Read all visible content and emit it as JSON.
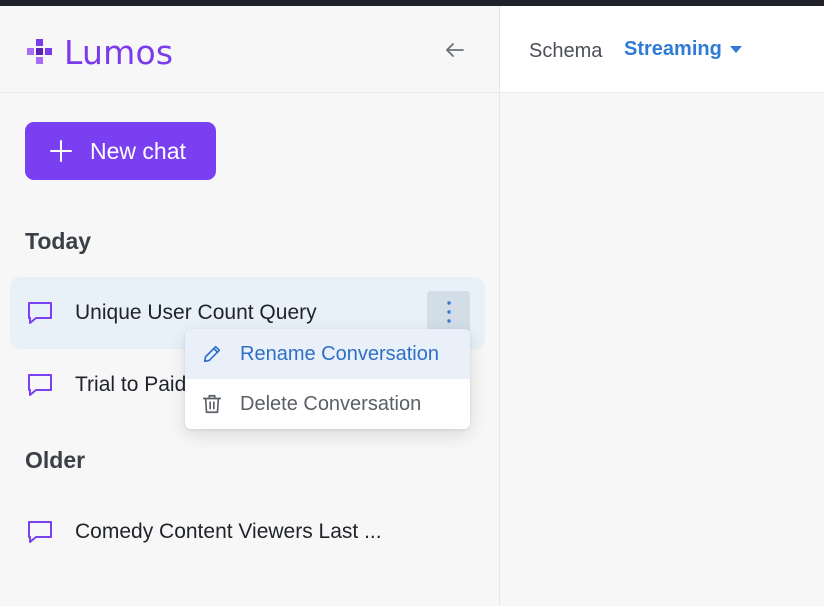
{
  "app": {
    "name": "Lumos",
    "brand_color": "#7c3aed"
  },
  "sidebar": {
    "new_chat_label": "New chat",
    "sections": [
      {
        "title": "Today",
        "conversations": [
          {
            "label": "Unique User Count Query",
            "active": true
          },
          {
            "label": "Trial to Paid",
            "active": false
          }
        ]
      },
      {
        "title": "Older",
        "conversations": [
          {
            "label": "Comedy Content Viewers Last ...",
            "active": false
          }
        ]
      }
    ],
    "context_menu": {
      "items": [
        {
          "label": "Rename Conversation",
          "icon": "pencil-icon",
          "color": "#2f6fc6"
        },
        {
          "label": "Delete Conversation",
          "icon": "trash-icon",
          "color": "#5b5f66"
        }
      ]
    }
  },
  "header": {
    "schema_label": "Schema",
    "schema_value": "Streaming",
    "accent_color": "#2f7bd6"
  }
}
